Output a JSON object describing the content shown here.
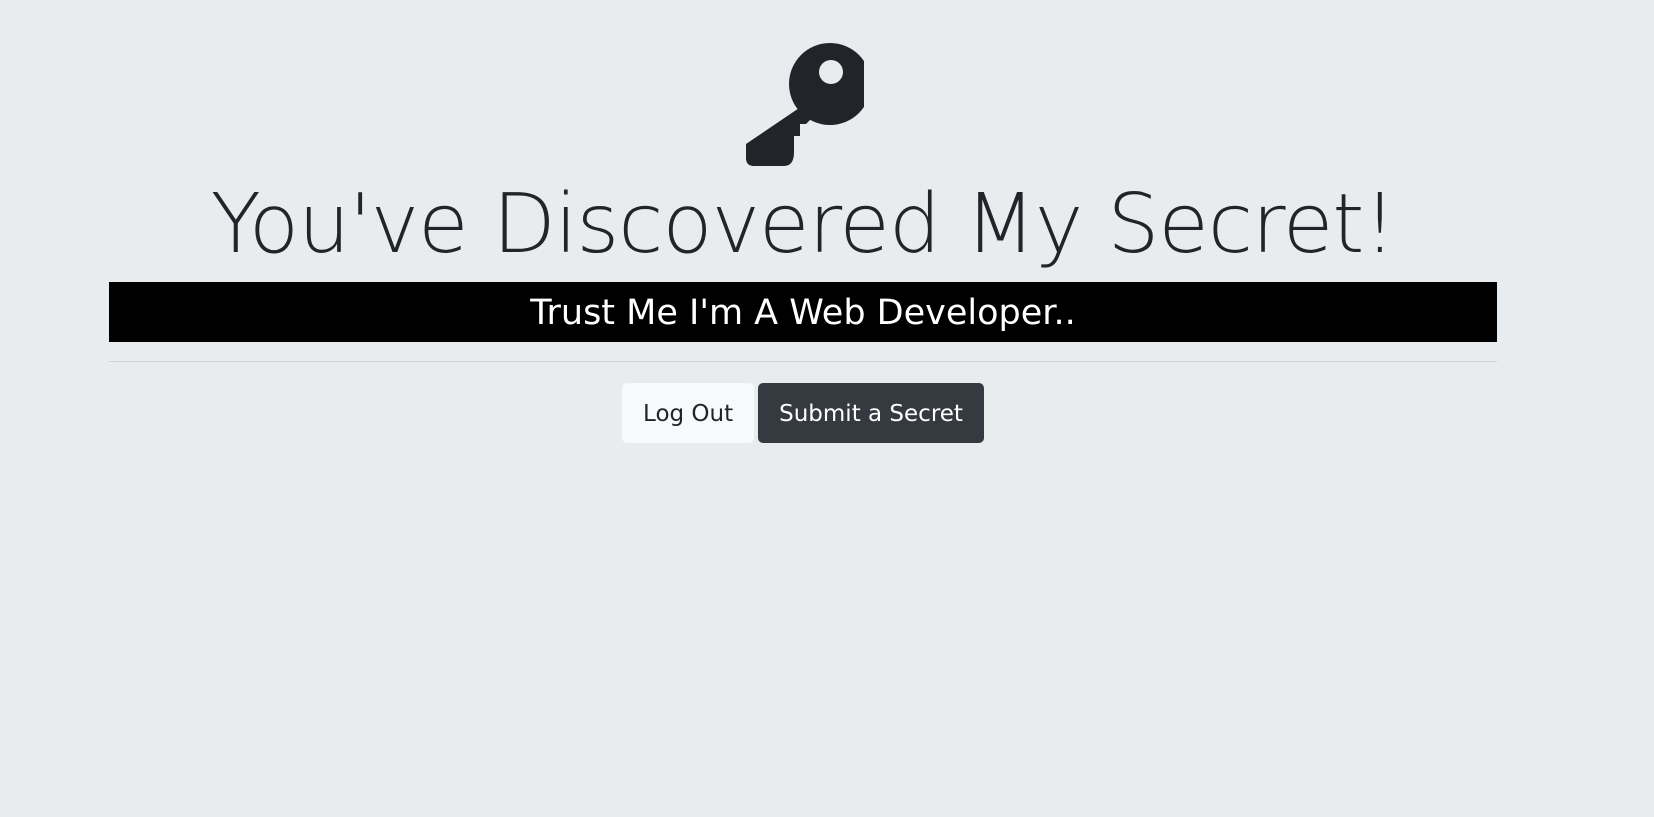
{
  "header": {
    "icon": "key-icon",
    "title": "You've Discovered My Secret!"
  },
  "secret": {
    "text": "Trust Me I'm A Web Developer.."
  },
  "actions": {
    "logout_label": "Log Out",
    "submit_label": "Submit a Secret"
  },
  "colors": {
    "background": "#e9ecef",
    "text": "#212529",
    "secret_bar": "#000000",
    "secret_text": "#ffffff",
    "button_light": "#f8f9fa",
    "button_dark": "#343a40"
  }
}
